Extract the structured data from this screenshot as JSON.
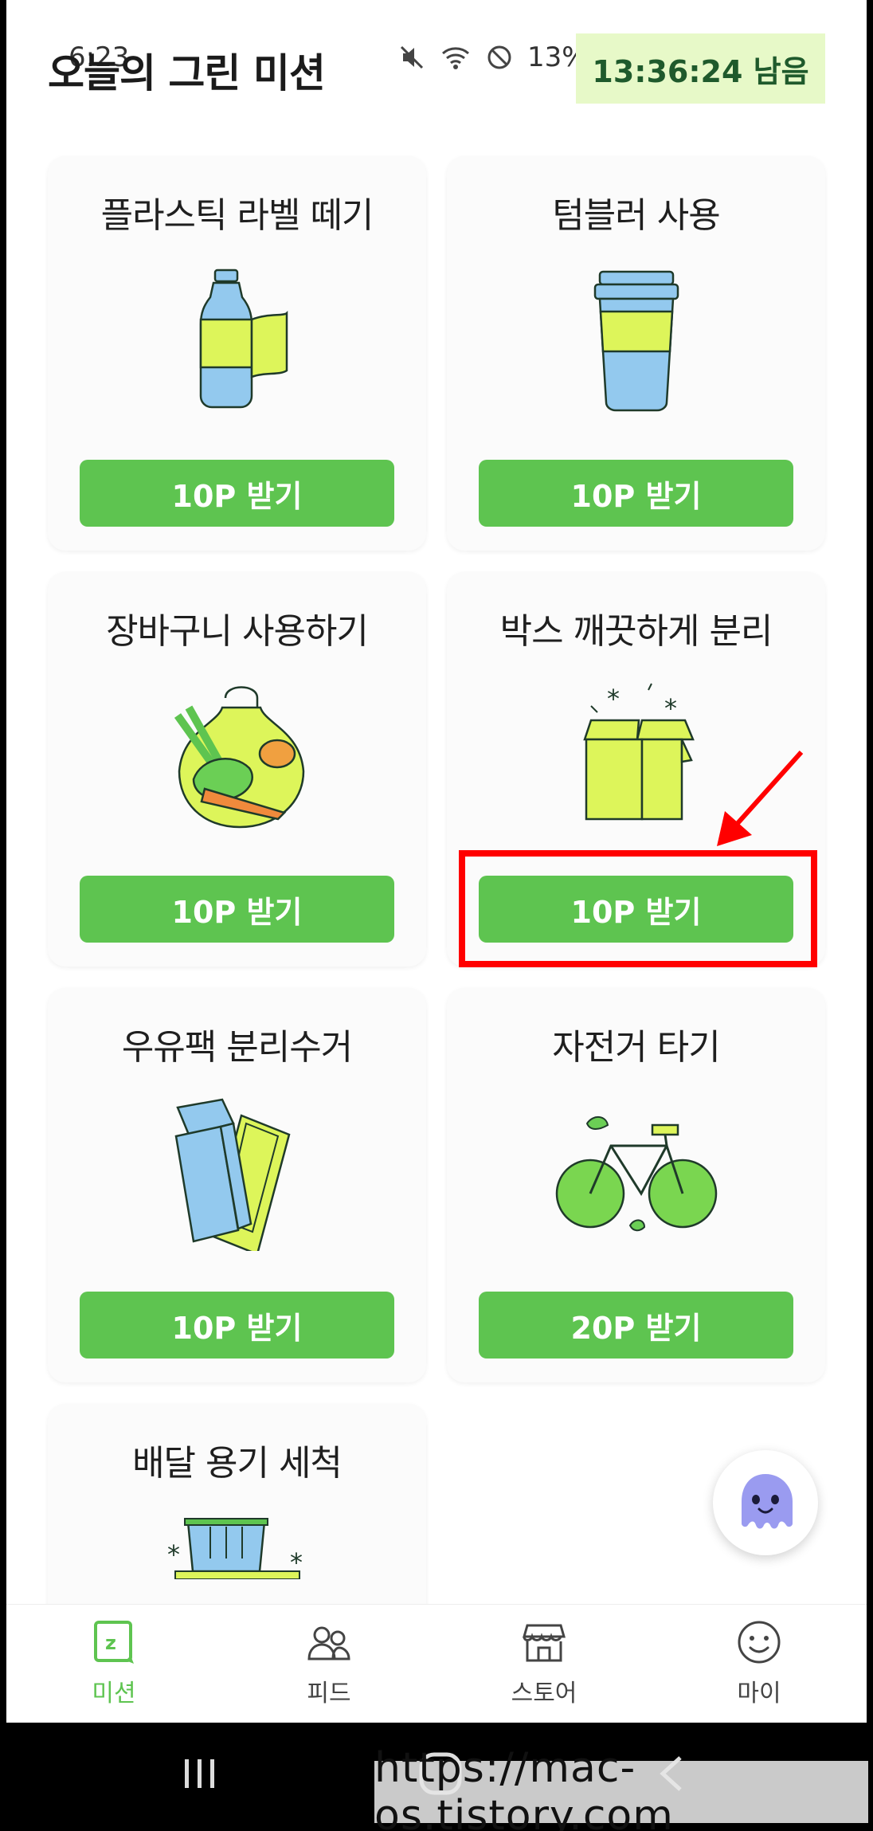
{
  "status_bar": {
    "time": "6:23",
    "battery_percent": "13%"
  },
  "header": {
    "title": "오늘의 그린 미션",
    "timer": "13:36:24 남음"
  },
  "missions": [
    {
      "title": "플라스틱 라벨 떼기",
      "button": "10P 받기",
      "icon": "plastic-bottle-icon"
    },
    {
      "title": "텀블러 사용",
      "button": "10P 받기",
      "icon": "tumbler-icon"
    },
    {
      "title": "장바구니 사용하기",
      "button": "10P 받기",
      "icon": "shopping-bag-icon"
    },
    {
      "title": "박스 깨끗하게 분리",
      "button": "10P 받기",
      "icon": "box-icon"
    },
    {
      "title": "우유팩 분리수거",
      "button": "10P 받기",
      "icon": "milk-carton-icon"
    },
    {
      "title": "자전거 타기",
      "button": "20P 받기",
      "icon": "bicycle-icon"
    },
    {
      "title": "배달 용기 세척",
      "button": "",
      "icon": "delivery-container-icon"
    }
  ],
  "bottom_nav": [
    {
      "label": "미션",
      "icon": "mission-icon",
      "active": true
    },
    {
      "label": "피드",
      "icon": "people-icon",
      "active": false
    },
    {
      "label": "스토어",
      "icon": "store-icon",
      "active": false
    },
    {
      "label": "마이",
      "icon": "smiley-icon",
      "active": false
    }
  ],
  "watermark": "https://mac-os.tistory.com",
  "colors": {
    "accent_green": "#5ec450",
    "timer_bg": "#e7f9c8",
    "highlight_red": "#ff0000",
    "illus_yellow": "#ddf55a",
    "illus_blue": "#93c9ee"
  }
}
